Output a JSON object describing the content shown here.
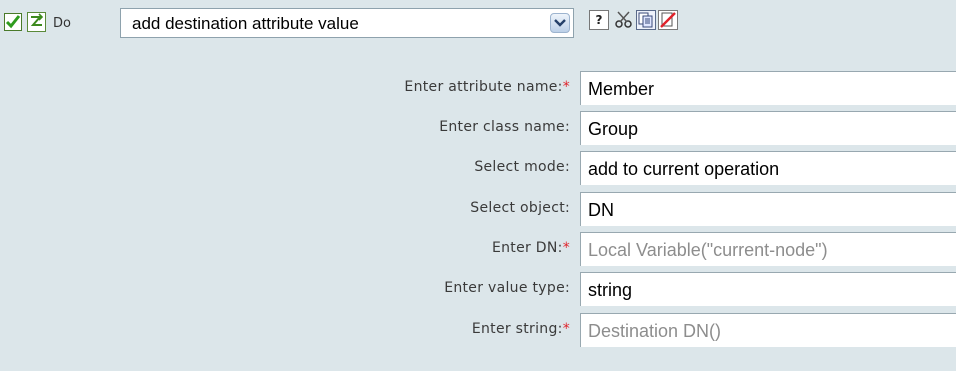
{
  "toolbar": {
    "do_label": "Do",
    "action_value": "add destination attribute value",
    "icons": {
      "enabled": "checkmark-icon",
      "toggle": "toggle-icon",
      "help": "help-icon",
      "help_glyph": "?",
      "cut": "scissors-icon",
      "copy": "copy-icon",
      "delete": "delete-icon"
    }
  },
  "form": {
    "rows": [
      {
        "label": "Enter attribute name:",
        "required": "*",
        "value": "Member",
        "placeholder": false
      },
      {
        "label": "Enter class name:",
        "required": "",
        "value": "Group",
        "placeholder": false
      },
      {
        "label": "Select mode:",
        "required": "",
        "value": "add to current operation",
        "placeholder": false
      },
      {
        "label": "Select object:",
        "required": "",
        "value": "DN",
        "placeholder": false
      },
      {
        "label": "Enter DN:",
        "required": "*",
        "value": "Local Variable(\"current-node\")",
        "placeholder": true
      },
      {
        "label": "Enter value type:",
        "required": "",
        "value": "string",
        "placeholder": false
      },
      {
        "label": "Enter string:",
        "required": "*",
        "value": "Destination DN()",
        "placeholder": true
      }
    ]
  },
  "colors": {
    "panel_bg": "#dce6ea",
    "required_marker": "#e0222a",
    "placeholder_text": "#8d8d8d"
  }
}
